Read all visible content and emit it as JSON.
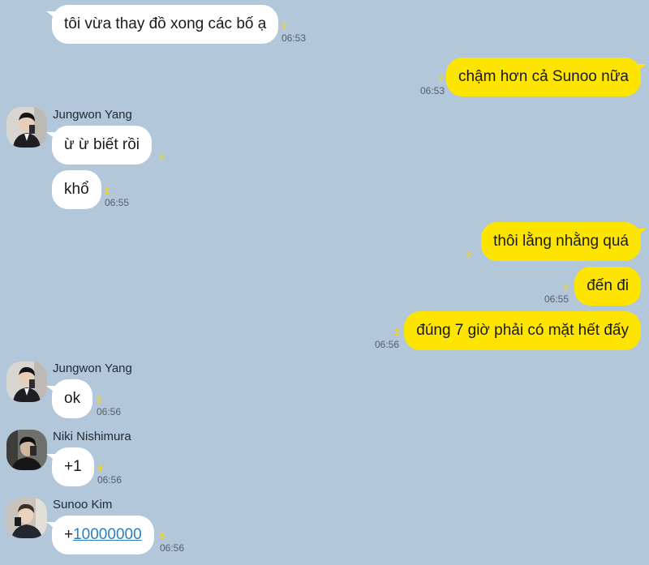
{
  "messages": [
    {
      "text": "tôi vừa thay đồ xong các bố ạ",
      "unread": "2",
      "time": "06:53",
      "mine": false
    },
    {
      "text": "chậm hơn cả Sunoo nữa",
      "unread": "2",
      "time": "06:53",
      "mine": true
    },
    {
      "sender": "Jungwon Yang",
      "text": "ừ ừ biết rồi",
      "unread": "2",
      "mine": false
    },
    {
      "text": "khổ",
      "unread": "2",
      "time": "06:55",
      "mine": false
    },
    {
      "text": "thôi lằng nhằng quá",
      "unread": "2",
      "mine": true
    },
    {
      "text": "đến đi",
      "unread": "2",
      "time": "06:55",
      "mine": true
    },
    {
      "text": "đúng 7 giờ phải có mặt hết đấy",
      "unread": "2",
      "time": "06:56",
      "mine": true
    },
    {
      "sender": "Jungwon Yang",
      "text": "ok",
      "unread": "3",
      "time": "06:56",
      "mine": false
    },
    {
      "sender": "Niki Nishimura",
      "text": "+1",
      "unread": "4",
      "time": "06:56",
      "mine": false
    },
    {
      "sender": "Sunoo Kim",
      "text_prefix": "+",
      "text_link": "10000000",
      "unread": "5",
      "time": "06:56",
      "mine": false
    }
  ],
  "colors": {
    "background": "#b2c7d9",
    "my_bubble": "#fee500",
    "their_bubble": "#ffffff",
    "unread": "#f2d41b",
    "link": "#2a7fbf"
  },
  "icons": {
    "avatar_jungwon": "avatar-jungwon-icon",
    "avatar_niki": "avatar-niki-icon",
    "avatar_sunoo": "avatar-sunoo-icon"
  }
}
